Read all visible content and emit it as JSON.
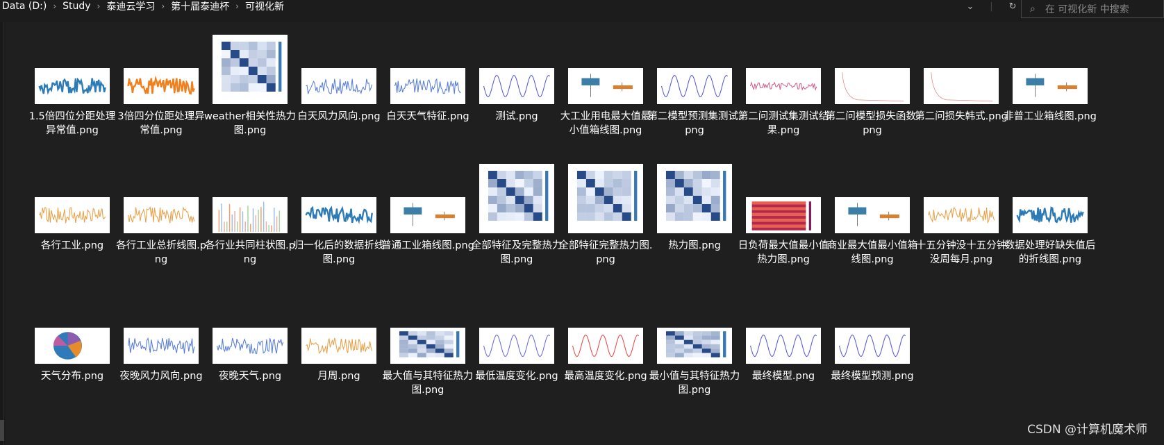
{
  "breadcrumb": [
    "Data (D:)",
    "Study",
    "泰迪云学习",
    "第十届泰迪杯",
    "可视化新"
  ],
  "search_placeholder": "在 可视化新 中搜索",
  "watermark": "CSDN @计算机魔术师",
  "files": [
    {
      "name": "1.5倍四位分距处理异常值.png",
      "icon": "blue-timeseries-thumbnail"
    },
    {
      "name": "3倍四分位距处理异常值.png",
      "icon": "orange-timeseries-thumbnail"
    },
    {
      "name": "weather相关性热力图.png",
      "icon": "heatmap-thumbnail"
    },
    {
      "name": "白天风力风向.png",
      "icon": "scatter-thumbnail"
    },
    {
      "name": "白天天气特征.png",
      "icon": "scatter-thumbnail"
    },
    {
      "name": "测试.png",
      "icon": "wave-thumbnail"
    },
    {
      "name": "大工业用电最大值最小值箱线图.png",
      "icon": "boxplot-thumbnail"
    },
    {
      "name": "第二模型预测集测试.png",
      "icon": "wave-thumbnail"
    },
    {
      "name": "第二问测试集测试结果.png",
      "icon": "line-thumbnail"
    },
    {
      "name": "第二问模型损失函数.png",
      "icon": "loss-thumbnail"
    },
    {
      "name": "第二问损失韩式.png",
      "icon": "loss-thumbnail"
    },
    {
      "name": "非普工业箱线图.png",
      "icon": "boxplot-thumbnail"
    },
    {
      "name": "各行工业.png",
      "icon": "multi-panel-thumbnail"
    },
    {
      "name": "各行工业总折线图.png",
      "icon": "multi-line-thumbnail"
    },
    {
      "name": "各行业共同柱状图.png",
      "icon": "bar-thumbnail"
    },
    {
      "name": "归一化后的数据折线图.png",
      "icon": "blue-timeseries-thumbnail"
    },
    {
      "name": "普通工业箱线图.png",
      "icon": "boxplot-thumbnail"
    },
    {
      "name": "全部特征及完整热力图.png",
      "icon": "heatmap-thumbnail"
    },
    {
      "name": "全部特征完整热力图.png",
      "icon": "heatmap-thumbnail"
    },
    {
      "name": "热力图.png",
      "icon": "heatmap-thumbnail"
    },
    {
      "name": "日负荷最大值最小值热力图.png",
      "icon": "stripe-heatmap-thumbnail"
    },
    {
      "name": "商业最大值最小值箱线图.png",
      "icon": "boxplot-thumbnail"
    },
    {
      "name": "十五分钟没十五分钟没周每月.png",
      "icon": "multi-panel-thumbnail"
    },
    {
      "name": "数据处理好缺失值后的折线图.png",
      "icon": "blue-timeseries-thumbnail"
    },
    {
      "name": "天气分布.png",
      "icon": "pie-thumbnail"
    },
    {
      "name": "夜晚风力风向.png",
      "icon": "scatter-thumbnail"
    },
    {
      "name": "夜晚天气.png",
      "icon": "scatter-thumbnail"
    },
    {
      "name": "月周.png",
      "icon": "multi-panel-thumbnail"
    },
    {
      "name": "最大值与其特征热力图.png",
      "icon": "heatmap-thumbnail"
    },
    {
      "name": "最低温度变化.png",
      "icon": "scatter-wave-thumbnail"
    },
    {
      "name": "最高温度变化.png",
      "icon": "scatter-wave-thumbnail"
    },
    {
      "name": "最小值与其特征热力图.png",
      "icon": "heatmap-thumbnail"
    },
    {
      "name": "最终模型.png",
      "icon": "wave-thumbnail"
    },
    {
      "name": "最终模型预测.png",
      "icon": "wave-thumbnail"
    }
  ]
}
